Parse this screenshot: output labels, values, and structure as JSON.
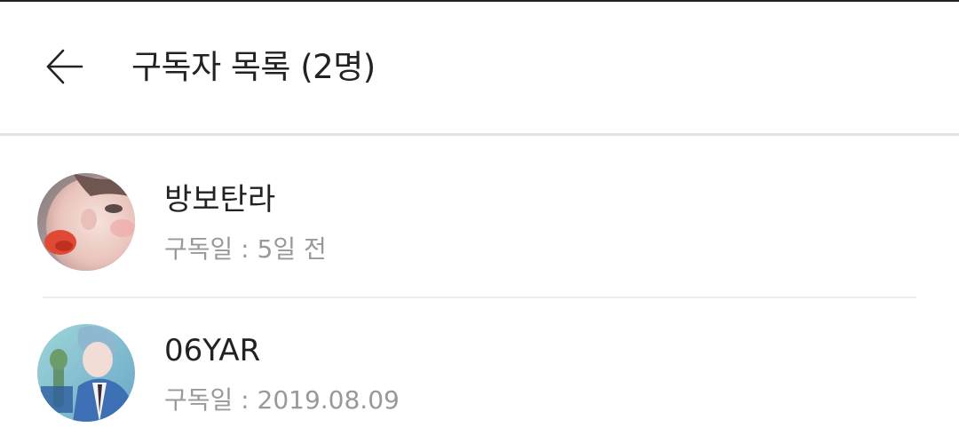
{
  "header": {
    "back_icon": "arrow-left-icon",
    "title": "구독자 목록 (2명)"
  },
  "subscribers": [
    {
      "name": "방보탄라",
      "subscribed_label": "구독일 : 5일 전",
      "avatar_icon": "user-avatar-photo"
    },
    {
      "name": "06YAR",
      "subscribed_label": "구독일 : 2019.08.09",
      "avatar_icon": "user-avatar-photo"
    }
  ],
  "colors": {
    "title_text": "#222222",
    "meta_text": "#999999",
    "divider": "#e4e4e4",
    "background": "#ffffff"
  }
}
